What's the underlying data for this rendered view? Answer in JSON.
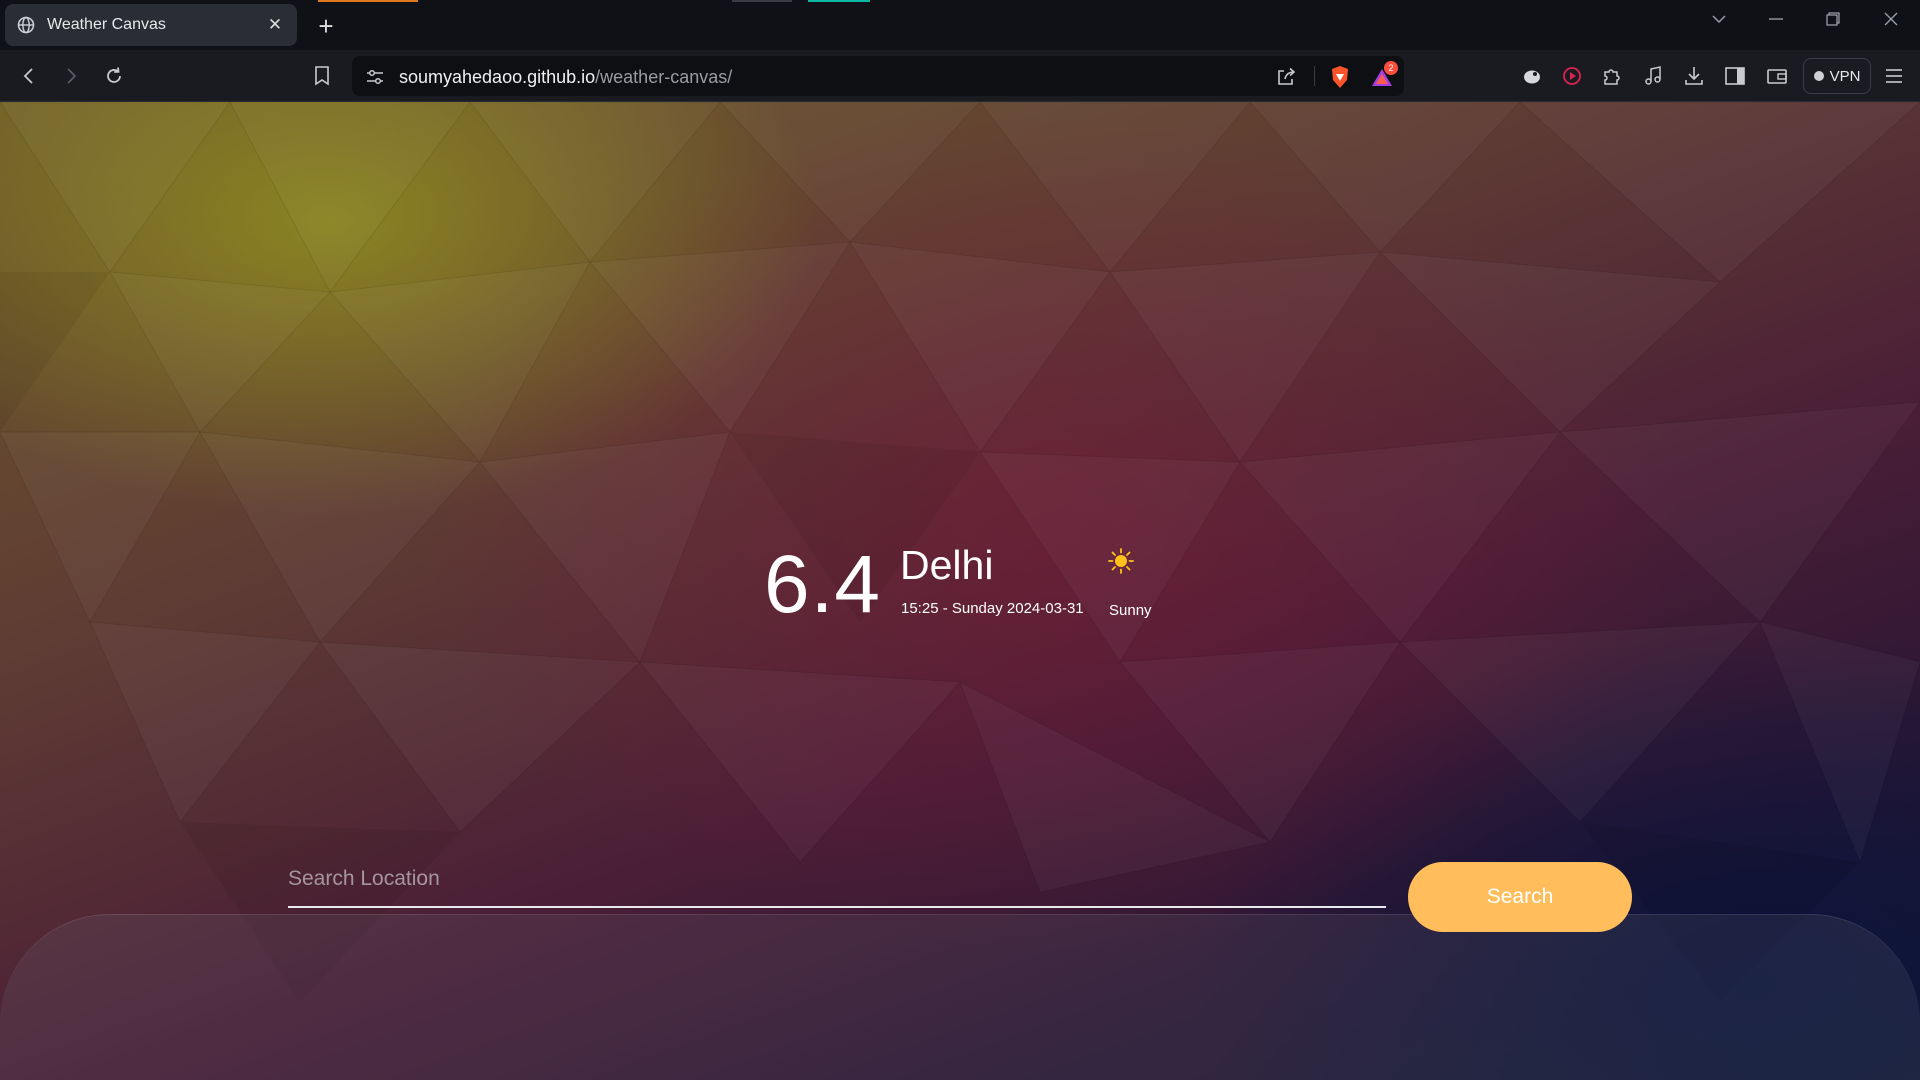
{
  "browser": {
    "tab": {
      "title": "Weather Canvas"
    },
    "address": {
      "domain": "soumyahedaoo.github.io",
      "path": "/weather-canvas/"
    },
    "shields_badge_count": "2",
    "vpn_label": "VPN",
    "accent_colors": [
      "#e0761e",
      "#3a3c43",
      "#0bb8a6"
    ]
  },
  "weather": {
    "temperature": "6.4",
    "city": "Delhi",
    "datetime": "15:25 - Sunday 2024-03-31",
    "condition": "Sunny",
    "condition_icon": "sun-icon"
  },
  "search": {
    "placeholder": "Search Location",
    "value": "",
    "button_label": "Search",
    "button_color": "#ffbe5b"
  }
}
